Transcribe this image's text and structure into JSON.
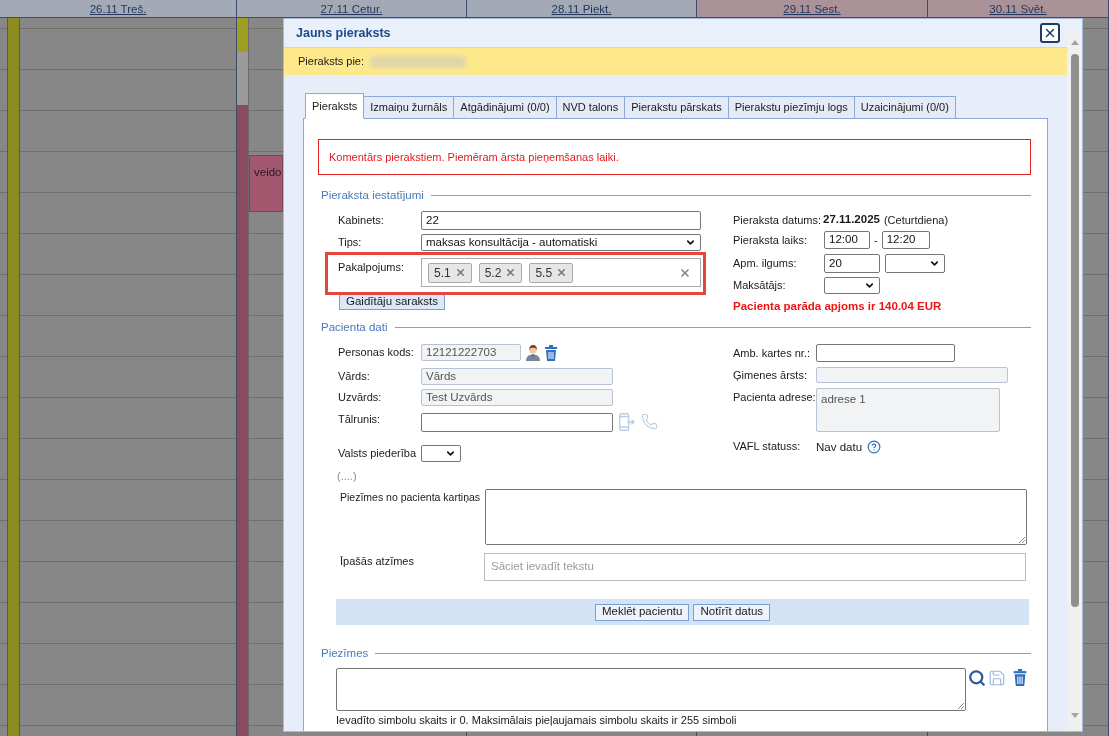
{
  "calendar": {
    "days": [
      {
        "label": "26.11 Treš.",
        "weekend": false
      },
      {
        "label": "27.11 Cetur.",
        "weekend": false
      },
      {
        "label": "28.11 Piekt.",
        "weekend": false
      },
      {
        "label": "29.11 Sest.",
        "weekend": true
      },
      {
        "label": "30.11 Svēt.",
        "weekend": true
      }
    ],
    "events": [
      {
        "text": "veido"
      }
    ]
  },
  "dialog": {
    "title": "Jauns pieraksts",
    "banner_label": "Pieraksts pie:",
    "tabs": [
      {
        "label": "Pieraksts",
        "selected": true
      },
      {
        "label": "Izmaiņu žurnāls",
        "selected": false
      },
      {
        "label": "Atgādinājumi (0/0)",
        "selected": false
      },
      {
        "label": "NVD talons",
        "selected": false
      },
      {
        "label": "Pierakstu pārskats",
        "selected": false
      },
      {
        "label": "Pierakstu piezīmju logs",
        "selected": false
      },
      {
        "label": "Uzaicinājumi (0/0)",
        "selected": false
      }
    ],
    "comment": "Komentārs pierakstiem. Piemēram ārsta pieņemšanas laiki.",
    "appointment_settings": {
      "legend": "Pieraksta iestatījumi",
      "fields": [
        {
          "kind": "input",
          "label": "Kabinets:",
          "value": "22"
        },
        {
          "kind": "select",
          "label": "Tips:",
          "value": "maksas konsultācija - automatiski"
        },
        {
          "kind": "tags",
          "label": "Pakalpojums:",
          "tags": [
            "5.1",
            "5.2",
            "5.5"
          ],
          "highlighted": true
        }
      ],
      "waitlist_button": "Gaidītāju saraksts",
      "date": {
        "label": "Pieraksta datums:",
        "value": "27.11.2025",
        "weekday": "(Ceturtdiena)"
      },
      "time": {
        "label": "Pieraksta laiks:",
        "from": "12:00",
        "separator": "-",
        "to": "12:20"
      },
      "duration": {
        "label": "Apm. ilgums:",
        "value": "20"
      },
      "payer": {
        "label": "Maksātājs:"
      },
      "debt_notice": "Pacienta parāda apjoms ir 140.04 EUR"
    },
    "patient": {
      "legend": "Pacienta dati",
      "left_fields": [
        {
          "kind": "code",
          "label": "Personas kods:",
          "value": "12121222703",
          "readonly": true
        },
        {
          "kind": "input",
          "label": "Vārds:",
          "value": "Vārds",
          "readonly": true
        },
        {
          "kind": "input",
          "label": "Uzvārds:",
          "value": "Test Uzvārds",
          "readonly": true
        },
        {
          "kind": "phone",
          "label": "Tālrunis:",
          "readonly": false,
          "actions_disabled": true
        },
        {
          "kind": "select",
          "label": "Valsts piederība"
        }
      ],
      "more_link": "(....)",
      "right_fields": [
        {
          "kind": "input",
          "label": "Amb. kartes nr.:",
          "readonly": false
        },
        {
          "kind": "input",
          "label": "Ģimenes ārsts:",
          "readonly": true
        },
        {
          "kind": "textarea",
          "label": "Pacienta adrese:",
          "value": "adrese 1",
          "readonly": true
        },
        {
          "kind": "status",
          "label": "VAFL statuss:",
          "value": "Nav datu"
        }
      ],
      "card_notes": {
        "label": "Piezīmes no pacienta kartiņas"
      },
      "special_marks": {
        "label": "Īpašās atzīmes",
        "placeholder": "Sāciet ievadīt tekstu"
      },
      "buttons": [
        "Meklēt pacientu",
        "Notīrīt datus"
      ]
    },
    "notes": {
      "legend": "Piezīmes",
      "counter": "Ievadīto simbolu skaits ir 0. Maksimālais pieļaujamais simbolu skaits ir 255 simboli"
    }
  }
}
